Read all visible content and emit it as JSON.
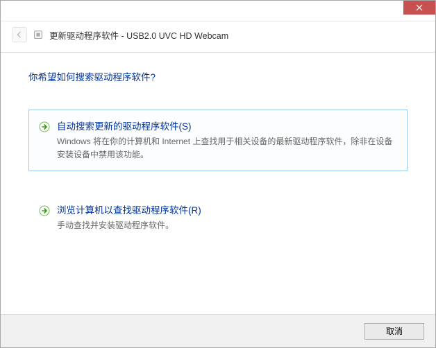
{
  "window": {
    "title": "更新驱动程序软件 - USB2.0 UVC HD Webcam"
  },
  "main": {
    "question": "你希望如何搜索驱动程序软件?",
    "options": [
      {
        "title": "自动搜索更新的驱动程序软件(S)",
        "desc": "Windows 将在你的计算机和 Internet 上查找用于相关设备的最新驱动程序软件，除非在设备安装设备中禁用该功能。"
      },
      {
        "title": "浏览计算机以查找驱动程序软件(R)",
        "desc": "手动查找并安装驱动程序软件。"
      }
    ]
  },
  "footer": {
    "cancel": "取消"
  }
}
